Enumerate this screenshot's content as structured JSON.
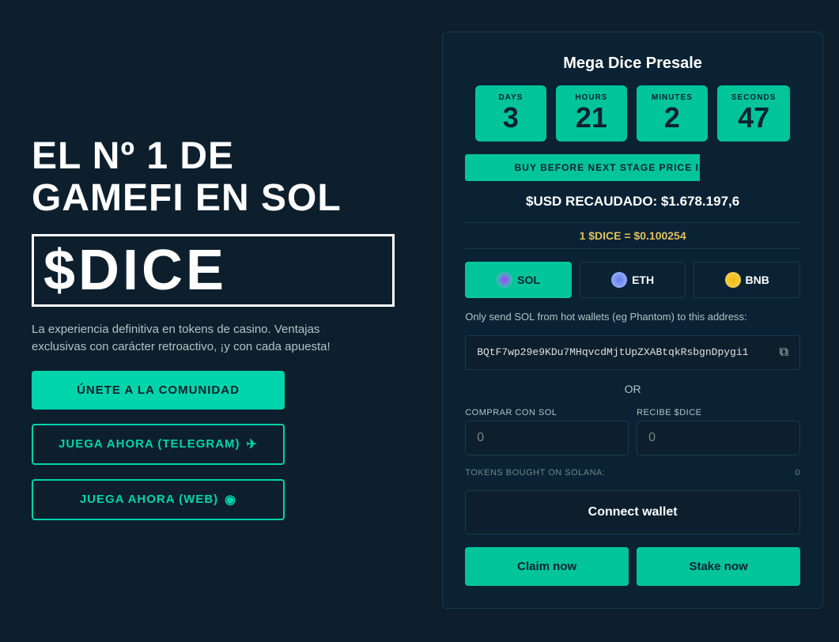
{
  "left": {
    "title": "EL Nº 1 DE GAMEFI EN SOL",
    "logo": "$DICE",
    "description": "La experiencia definitiva en tokens de casino. Ventajas exclusivas con carácter retroactivo, ¡y con cada apuesta!",
    "btn_join": "ÚNETE A LA COMUNIDAD",
    "btn_telegram": "JUEGA AHORA (TELEGRAM)",
    "btn_web": "JUEGA AHORA (WEB)"
  },
  "right": {
    "title": "Mega Dice Presale",
    "timer": {
      "days_label": "DAYS",
      "days_value": "3",
      "hours_label": "HOURS",
      "hours_value": "21",
      "minutes_label": "MINUTES",
      "minutes_value": "2",
      "seconds_label": "SECONDS",
      "seconds_value": "47"
    },
    "stage_bar": "BUY BEFORE NEXT STAGE PRICE INCREASE",
    "usd_raised": "$USD RECAUDADO: $1.678.197,6",
    "price": "1 $DICE = $0.100254",
    "currencies": [
      {
        "label": "SOL",
        "icon": "sol",
        "active": true
      },
      {
        "label": "ETH",
        "icon": "eth",
        "active": false
      },
      {
        "label": "BNB",
        "icon": "bnb",
        "active": false
      }
    ],
    "send_info": "Only send SOL from hot wallets (eg Phantom) to this address:",
    "address": "BQtF7wp29e9KDu7MHqvcdMjtUpZXABtqkRsbgnDpygi1",
    "or_label": "OR",
    "buy_label": "Comprar con SOL",
    "buy_placeholder": "0",
    "receive_label": "Recibe $Dice",
    "receive_placeholder": "0",
    "tokens_bought_label": "TOKENS BOUGHT ON SOLANA:",
    "tokens_bought_value": "0",
    "connect_wallet": "Connect wallet",
    "claim_label": "Claim now",
    "stake_label": "Stake now"
  }
}
